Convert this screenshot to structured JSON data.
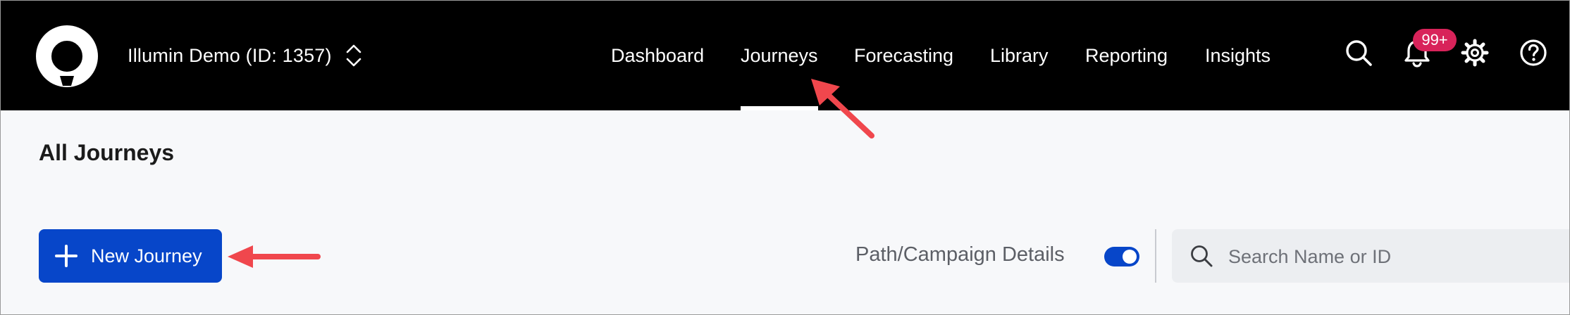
{
  "header": {
    "workspace": "Illumin Demo (ID: 1357)",
    "nav": [
      {
        "label": "Dashboard",
        "active": false
      },
      {
        "label": "Journeys",
        "active": true
      },
      {
        "label": "Forecasting",
        "active": false
      },
      {
        "label": "Library",
        "active": false
      },
      {
        "label": "Reporting",
        "active": false
      },
      {
        "label": "Insights",
        "active": false
      }
    ],
    "icons": [
      "search-icon",
      "bell-icon",
      "gear-icon",
      "help-icon"
    ],
    "notification_badge": "99+"
  },
  "main": {
    "title": "All Journeys",
    "new_button_label": "New Journey",
    "toggle_label": "Path/Campaign Details",
    "toggle_on": true,
    "search_placeholder": "Search Name or ID"
  },
  "colors": {
    "header_bg": "#000000",
    "page_bg": "#f7f8fa",
    "primary": "#0746c9",
    "badge": "#d8235a",
    "annotation_arrow": "#f0474d"
  }
}
